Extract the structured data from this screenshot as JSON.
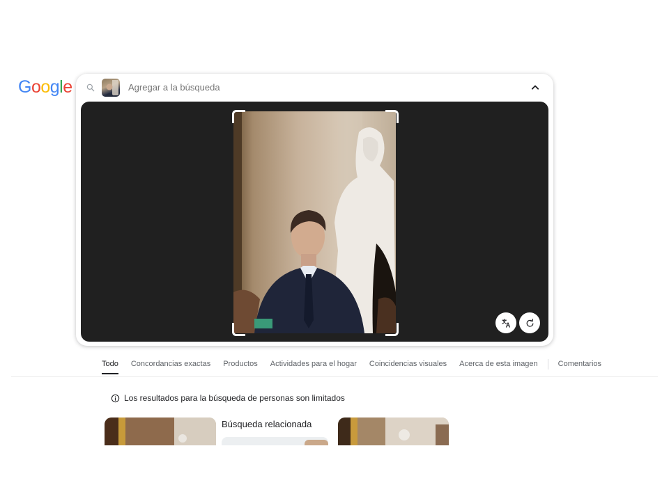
{
  "logo": {
    "text": "Google",
    "letters": [
      "G",
      "o",
      "o",
      "g",
      "l",
      "e"
    ],
    "colors": [
      "#4285F4",
      "#EA4335",
      "#FBBC05",
      "#4285F4",
      "#34A853",
      "#EA4335"
    ]
  },
  "search": {
    "placeholder": "Agregar a la búsqueda",
    "icon": "search-icon",
    "collapse_icon": "chevron-up-icon"
  },
  "viewer": {
    "background": "#202020",
    "buttons": [
      {
        "name": "translate-button",
        "icon": "translate-icon"
      },
      {
        "name": "refresh-button",
        "icon": "refresh-icon"
      }
    ]
  },
  "tabs": [
    {
      "label": "Todo",
      "active": true
    },
    {
      "label": "Concordancias exactas"
    },
    {
      "label": "Productos"
    },
    {
      "label": "Actividades para el hogar"
    },
    {
      "label": "Coincidencias visuales"
    },
    {
      "label": "Acerca de esta imagen"
    },
    {
      "label": "Comentarios"
    }
  ],
  "notice": {
    "text": "Los resultados para la búsqueda de personas son limitados",
    "icon": "info-icon"
  },
  "results": {
    "related_title": "Búsqueda relacionada"
  }
}
